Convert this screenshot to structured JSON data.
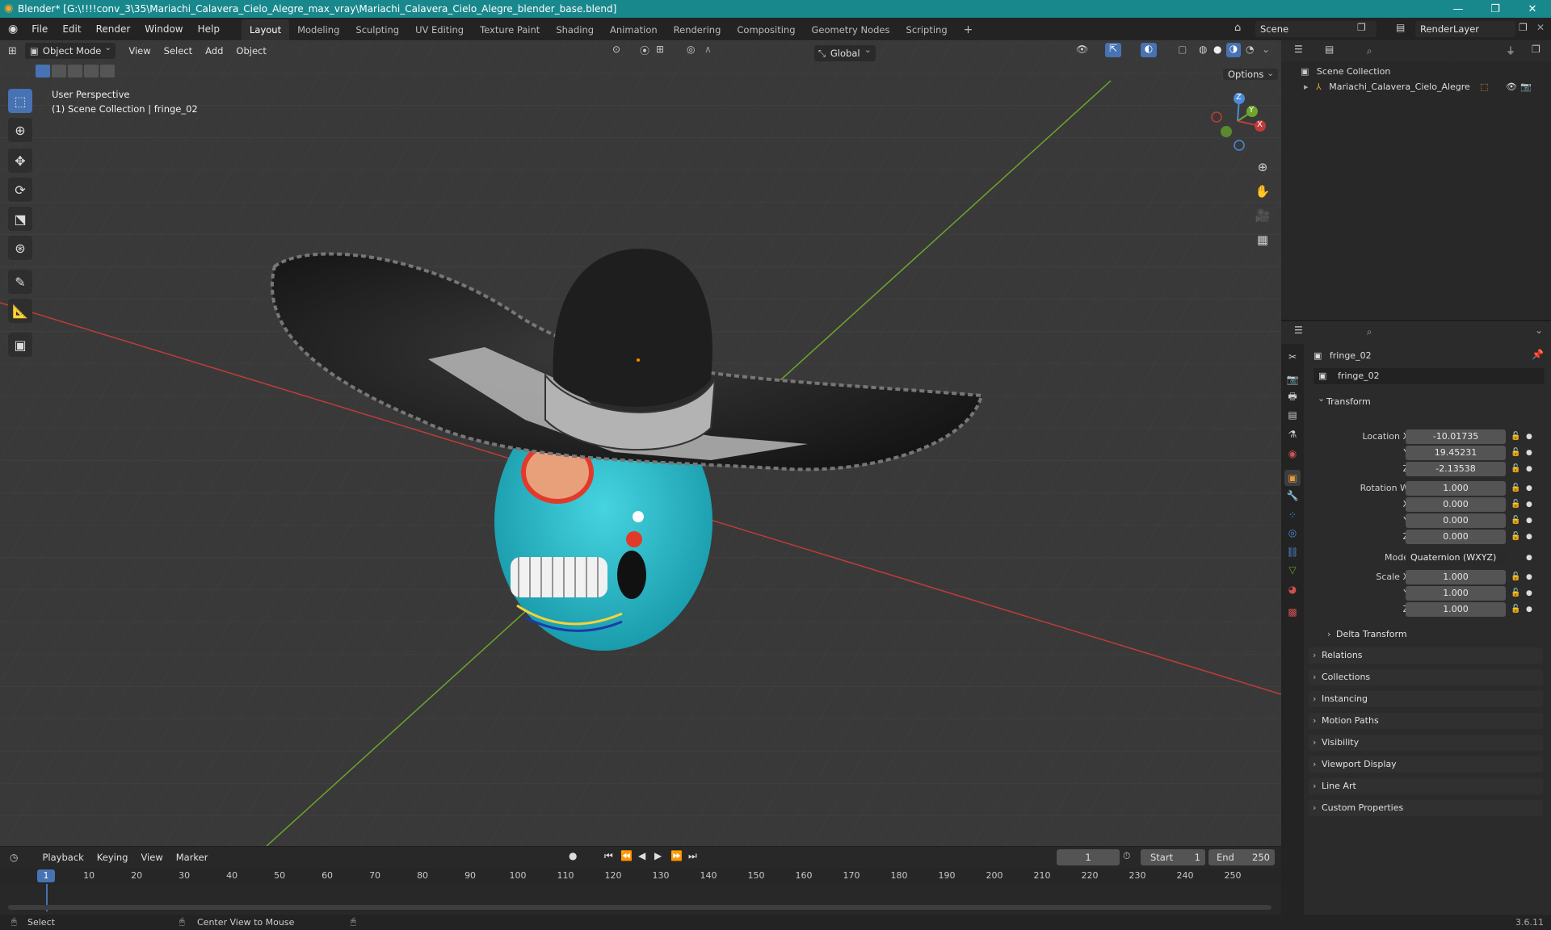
{
  "window": {
    "title": "Blender* [G:\\!!!!conv_3\\35\\Mariachi_Calavera_Cielo_Alegre_max_vray\\Mariachi_Calavera_Cielo_Alegre_blender_base.blend]",
    "minimize": "—",
    "maximize": "❐",
    "close": "✕"
  },
  "menu": [
    "File",
    "Edit",
    "Render",
    "Window",
    "Help"
  ],
  "workspaces": [
    "Layout",
    "Modeling",
    "Sculpting",
    "UV Editing",
    "Texture Paint",
    "Shading",
    "Animation",
    "Rendering",
    "Compositing",
    "Geometry Nodes",
    "Scripting"
  ],
  "workspace_add": "+",
  "scene": {
    "name": "Scene",
    "view_layer": "RenderLayer"
  },
  "viewport": {
    "mode": "Object Mode",
    "menus": [
      "View",
      "Select",
      "Add",
      "Object"
    ],
    "orientation": "Global",
    "options": "Options",
    "overlay_title": "User Perspective",
    "overlay_sub": "(1) Scene Collection | fringe_02",
    "gizmo": {
      "z": "Z",
      "y": "Y",
      "x": "X"
    }
  },
  "outliner": {
    "root": "Scene Collection",
    "items": [
      {
        "label": "Mariachi_Calavera_Cielo_Alegre"
      }
    ]
  },
  "properties": {
    "object_name": "fringe_02",
    "data_name": "fringe_02",
    "transform_title": "Transform",
    "location": {
      "label_x": "Location X",
      "label_y": "Y",
      "label_z": "Z",
      "x": "-10.01735",
      "y": "19.45231",
      "z": "-2.13538"
    },
    "rotation": {
      "label_w": "Rotation W",
      "label_x": "X",
      "label_y": "Y",
      "label_z": "Z",
      "w": "1.000",
      "x": "0.000",
      "y": "0.000",
      "z": "0.000"
    },
    "mode_label": "Mode",
    "mode_value": "Quaternion (WXYZ)",
    "scale": {
      "label_x": "Scale X",
      "label_y": "Y",
      "label_z": "Z",
      "x": "1.000",
      "y": "1.000",
      "z": "1.000"
    },
    "delta_transform": "Delta Transform",
    "panels": [
      "Relations",
      "Collections",
      "Instancing",
      "Motion Paths",
      "Visibility",
      "Viewport Display",
      "Line Art",
      "Custom Properties"
    ]
  },
  "timeline": {
    "menus": [
      "Playback",
      "Keying",
      "View",
      "Marker"
    ],
    "current_frame": "1",
    "start_label": "Start",
    "start": "1",
    "end_label": "End",
    "end": "250",
    "ticks": [
      "1",
      "10",
      "20",
      "30",
      "40",
      "50",
      "60",
      "70",
      "80",
      "90",
      "100",
      "110",
      "120",
      "130",
      "140",
      "150",
      "160",
      "170",
      "180",
      "190",
      "200",
      "210",
      "220",
      "230",
      "240",
      "250"
    ]
  },
  "status": {
    "select": "Select",
    "center_view": "Center View to Mouse",
    "version": "3.6.11"
  },
  "colors": {
    "accent": "#4772b3",
    "titlebar": "#19888d",
    "x_axis": "#c13b3b",
    "y_axis": "#6fa52b",
    "skull": "#26b8c9"
  }
}
